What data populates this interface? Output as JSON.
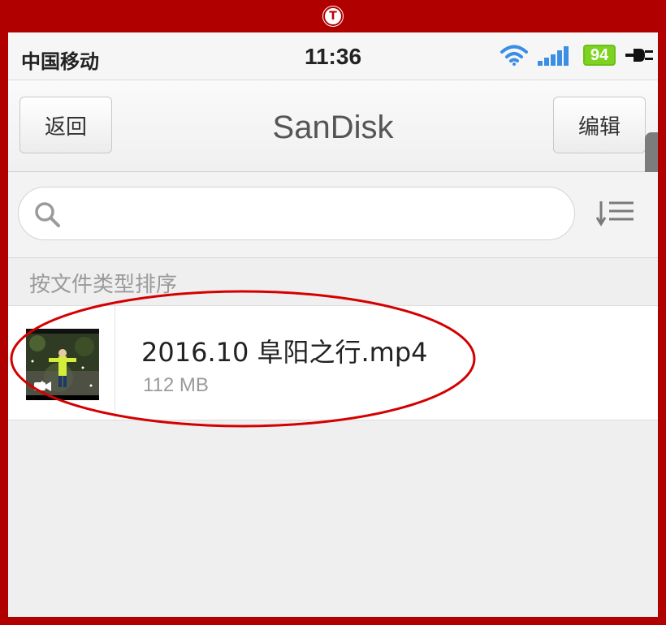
{
  "status_bar": {
    "carrier": "中国移动",
    "time": "11:36",
    "battery": "94"
  },
  "nav": {
    "back_label": "返回",
    "title": "SanDisk",
    "edit_label": "编辑"
  },
  "search": {
    "value": "",
    "placeholder": ""
  },
  "section": {
    "header": "按文件类型排序"
  },
  "files": [
    {
      "name": "2016.10 阜阳之行.mp4",
      "size": "112 MB",
      "type": "video"
    }
  ],
  "overlay": {
    "badge": "T"
  },
  "icons": [
    "wifi-icon",
    "signal-icon",
    "battery-icon",
    "plug-icon",
    "search-icon",
    "sort-icon",
    "video-camera-icon"
  ],
  "colors": {
    "frame": "#b00000",
    "battery": "#7ed321",
    "wifi": "#3a8ee6",
    "annotation": "#d40000"
  }
}
